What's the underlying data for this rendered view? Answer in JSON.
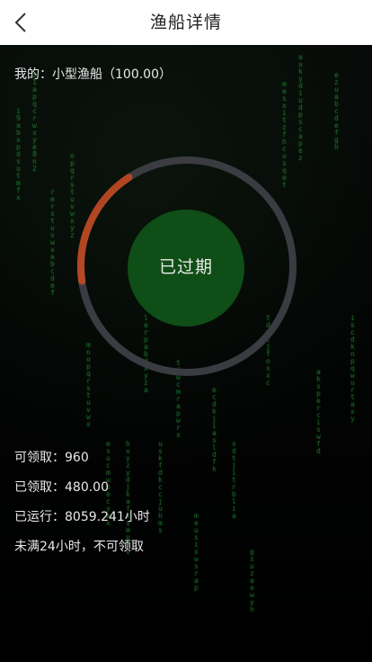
{
  "header": {
    "title": "渔船详情",
    "back_icon": "chevron-left-icon"
  },
  "mine": {
    "label": "我的：小型渔船（100.00）"
  },
  "status": {
    "label": "已过期",
    "progress_fraction": 0.18
  },
  "colors": {
    "accent_green": "#0f4e16",
    "ring_gray": "#3a3c42",
    "ring_orange": "#d25b2d"
  },
  "stats": {
    "available": "可领取：960",
    "received": "已领取：480.00",
    "runtime": "已运行：8059.241小时",
    "notice": "未满24小时，不可领取"
  }
}
